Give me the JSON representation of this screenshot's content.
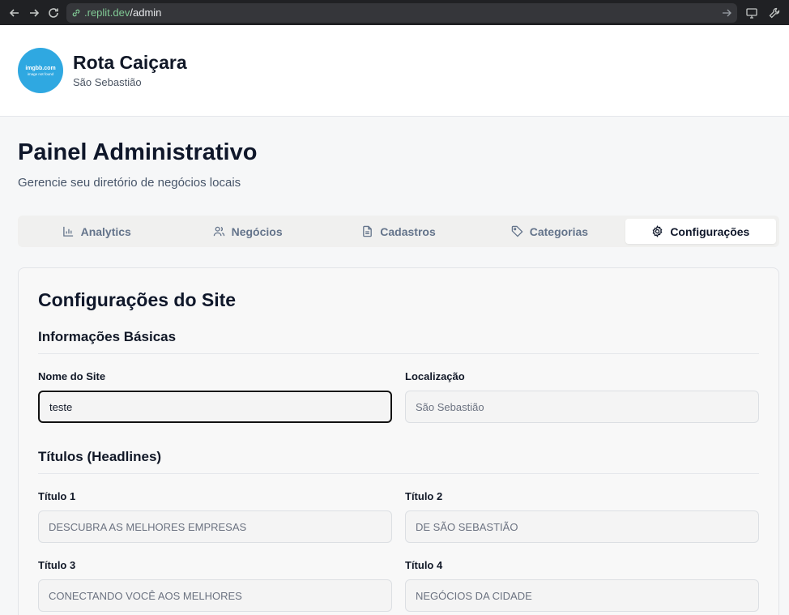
{
  "browser": {
    "url_domain": ".replit.dev",
    "url_path": "/admin"
  },
  "header": {
    "logo_text": "imgbb.com",
    "logo_sub": "image not found",
    "site_name": "Rota Caiçara",
    "location": "São Sebastião"
  },
  "page": {
    "title": "Painel Administrativo",
    "subtitle": "Gerencie seu diretório de negócios locais"
  },
  "tabs": [
    {
      "label": "Analytics",
      "icon": "bar-chart-icon",
      "active": false
    },
    {
      "label": "Negócios",
      "icon": "users-icon",
      "active": false
    },
    {
      "label": "Cadastros",
      "icon": "document-icon",
      "active": false
    },
    {
      "label": "Categorias",
      "icon": "tag-icon",
      "active": false
    },
    {
      "label": "Configurações",
      "icon": "gear-icon",
      "active": true
    }
  ],
  "settings": {
    "title": "Configurações do Site",
    "basic": {
      "section_title": "Informações Básicas",
      "site_name_label": "Nome do Site",
      "site_name_value": "teste",
      "location_label": "Localização",
      "location_placeholder": "São Sebastião"
    },
    "headlines": {
      "section_title": "Títulos (Headlines)",
      "title1_label": "Título 1",
      "title1_placeholder": "DESCUBRA AS MELHORES EMPRESAS",
      "title2_label": "Título 2",
      "title2_placeholder": "DE SÃO SEBASTIÃO",
      "title3_label": "Título 3",
      "title3_placeholder": "CONECTANDO VOCÊ AOS MELHORES",
      "title4_label": "Título 4",
      "title4_placeholder": "NEGÓCIOS DA CIDADE"
    }
  }
}
